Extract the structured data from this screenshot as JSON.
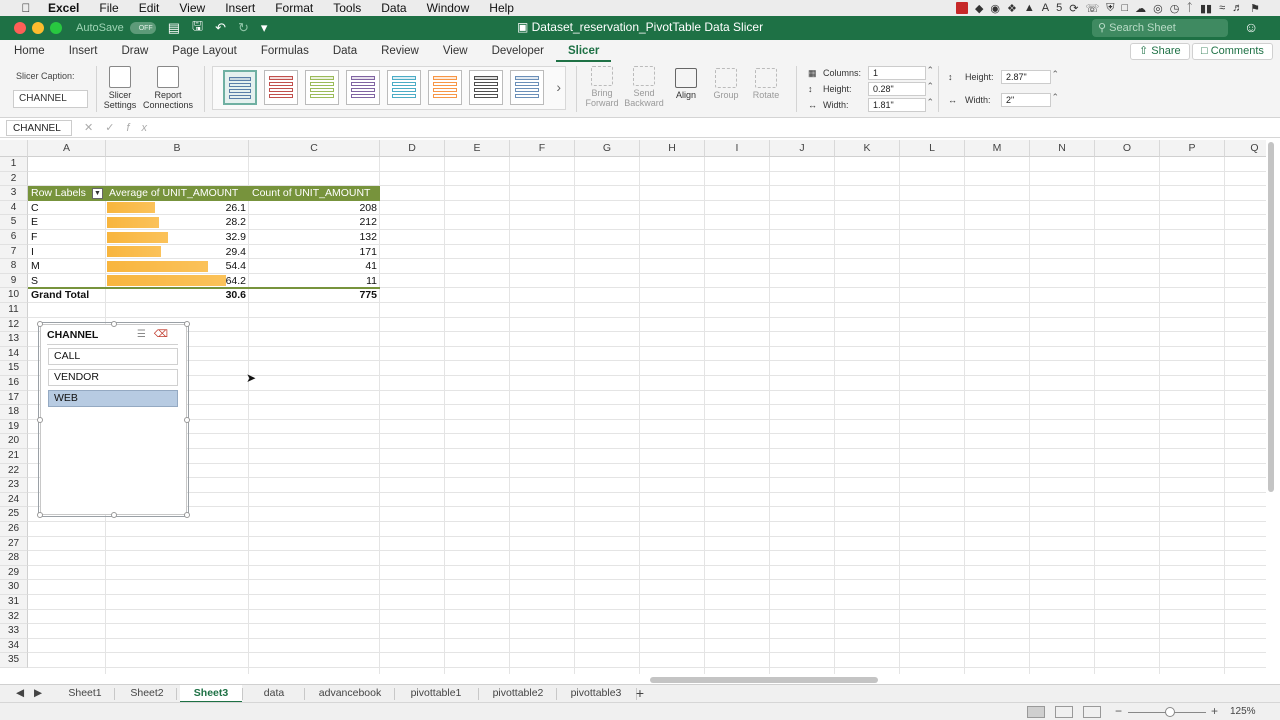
{
  "menubar": {
    "app": "Excel",
    "items": [
      "File",
      "Edit",
      "View",
      "Insert",
      "Format",
      "Tools",
      "Data",
      "Window",
      "Help"
    ],
    "status_text": "5"
  },
  "titlebar": {
    "autosave": "AutoSave",
    "toggle": "OFF",
    "title": "Dataset_reservation_PivotTable Data Slicer",
    "search_placeholder": "Search Sheet"
  },
  "ribbon_tabs": [
    "Home",
    "Insert",
    "Draw",
    "Page Layout",
    "Formulas",
    "Data",
    "Review",
    "View",
    "Developer",
    "Slicer"
  ],
  "active_tab": "Slicer",
  "share_label": "Share",
  "comments_label": "Comments",
  "ribbon": {
    "caption_label": "Slicer Caption:",
    "caption_value": "CHANNEL",
    "slicer_settings": [
      "Slicer",
      "Settings"
    ],
    "report_connections": [
      "Report",
      "Connections"
    ],
    "bring_forward": [
      "Bring",
      "Forward"
    ],
    "send_backward": [
      "Send",
      "Backward"
    ],
    "align": "Align",
    "group": "Group",
    "rotate": "Rotate",
    "columns_label": "Columns:",
    "columns_value": "1",
    "height_label": "Height:",
    "height_value": "0.28\"",
    "width_label": "Width:",
    "width_value": "1.81\"",
    "slicer_height_label": "Height:",
    "slicer_height_value": "2.87\"",
    "slicer_width_label": "Width:",
    "slicer_width_value": "2\"",
    "style_colors": [
      "#5a7fa8",
      "#c0504d",
      "#9bbb59",
      "#8064a2",
      "#4bacc6",
      "#f79646",
      "#4f4f4f",
      "#6b8fb8"
    ]
  },
  "formula_bar": {
    "name_box": "CHANNEL",
    "fx": "fx"
  },
  "columns": [
    "A",
    "B",
    "C",
    "D",
    "E",
    "F",
    "G",
    "H",
    "I",
    "J",
    "K",
    "L",
    "M",
    "N",
    "O",
    "P",
    "Q"
  ],
  "rows": [
    "1",
    "2",
    "3",
    "4",
    "5",
    "6",
    "7",
    "8",
    "9",
    "10",
    "11",
    "12",
    "13",
    "14",
    "15",
    "16",
    "17",
    "18",
    "19",
    "20",
    "21",
    "22",
    "23",
    "24",
    "25",
    "26",
    "27",
    "28",
    "29",
    "30",
    "31",
    "32",
    "33",
    "34",
    "35"
  ],
  "pivot": {
    "headers": [
      "Row Labels",
      "Average of UNIT_AMOUNT",
      "Count of UNIT_AMOUNT"
    ],
    "bar_color": "#f8b53d",
    "header_color": "#77933c",
    "bar_max": 64.2,
    "rows": [
      {
        "label": "C",
        "avg": "26.1",
        "count": "208",
        "avg_value": 26.1
      },
      {
        "label": "E",
        "avg": "28.2",
        "count": "212",
        "avg_value": 28.2
      },
      {
        "label": "F",
        "avg": "32.9",
        "count": "132",
        "avg_value": 32.9
      },
      {
        "label": "I",
        "avg": "29.4",
        "count": "171",
        "avg_value": 29.4
      },
      {
        "label": "M",
        "avg": "54.4",
        "count": "41",
        "avg_value": 54.4
      },
      {
        "label": "S",
        "avg": "64.2",
        "count": "11",
        "avg_value": 64.2
      }
    ],
    "total": {
      "label": "Grand Total",
      "avg": "30.6",
      "count": "775"
    }
  },
  "slicer": {
    "title": "CHANNEL",
    "items": [
      {
        "label": "CALL",
        "selected": false
      },
      {
        "label": "VENDOR",
        "selected": false
      },
      {
        "label": "WEB",
        "selected": true
      }
    ]
  },
  "sheets": [
    "Sheet1",
    "Sheet2",
    "Sheet3",
    "data",
    "advancebook",
    "pivottable1",
    "pivottable2",
    "pivottable3"
  ],
  "active_sheet": "Sheet3",
  "zoom": "125%"
}
